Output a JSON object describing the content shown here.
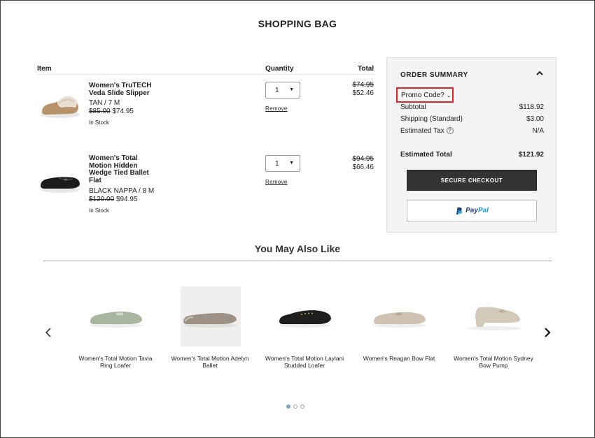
{
  "page": {
    "title": "SHOPPING BAG"
  },
  "cart": {
    "headers": {
      "item": "Item",
      "quantity": "Quantity",
      "total": "Total"
    },
    "items": [
      {
        "name": "Women's TruTECH Veda Slide Slipper",
        "variant": "TAN / 7 M",
        "old_price": "$85.00",
        "price": "$74.95",
        "stock": "In Stock",
        "quantity": "1",
        "remove": "Remove",
        "total_old": "$74.95",
        "total": "$52.46",
        "icon": "slipper-image"
      },
      {
        "name": "Women's Total Motion Hidden Wedge Tied Ballet Flat",
        "variant": "BLACK NAPPA / 8 M",
        "old_price": "$120.00",
        "price": "$94.95",
        "stock": "In Stock",
        "quantity": "1",
        "remove": "Remove",
        "total_old": "$94.95",
        "total": "$66.46",
        "icon": "ballet-flat-image"
      }
    ]
  },
  "summary": {
    "title": "ORDER SUMMARY",
    "promo_label": "Promo Code?",
    "rows": {
      "subtotal": {
        "label": "Subtotal",
        "value": "$118.92"
      },
      "shipping": {
        "label": "Shipping (Standard)",
        "value": "$3.00"
      },
      "tax": {
        "label": "Estimated Tax",
        "value": "N/A"
      },
      "total": {
        "label": "Estimated Total",
        "value": "$121.92"
      }
    },
    "checkout_label": "SECURE CHECKOUT",
    "paypal": {
      "word1": "Pay",
      "word2": "Pal"
    },
    "highlight_color": "#e0282b"
  },
  "recommendations": {
    "title": "You May Also Like",
    "items": [
      {
        "name": "Women's Total Motion Tavia Ring Loafer",
        "color": "#a9b7a1"
      },
      {
        "name": "Women's Total Motion Adelyn Ballet",
        "color": "#9c9184"
      },
      {
        "name": "Women's Total Motion Laylani Studded Loafer",
        "color": "#1e1e1e"
      },
      {
        "name": "Women's Reagan Bow Flat",
        "color": "#cfc2b3"
      },
      {
        "name": "Women's Total Motion Sydney Bow Pump",
        "color": "#d3c9b8"
      }
    ],
    "pagination": {
      "pages": 3,
      "active": 1
    }
  }
}
